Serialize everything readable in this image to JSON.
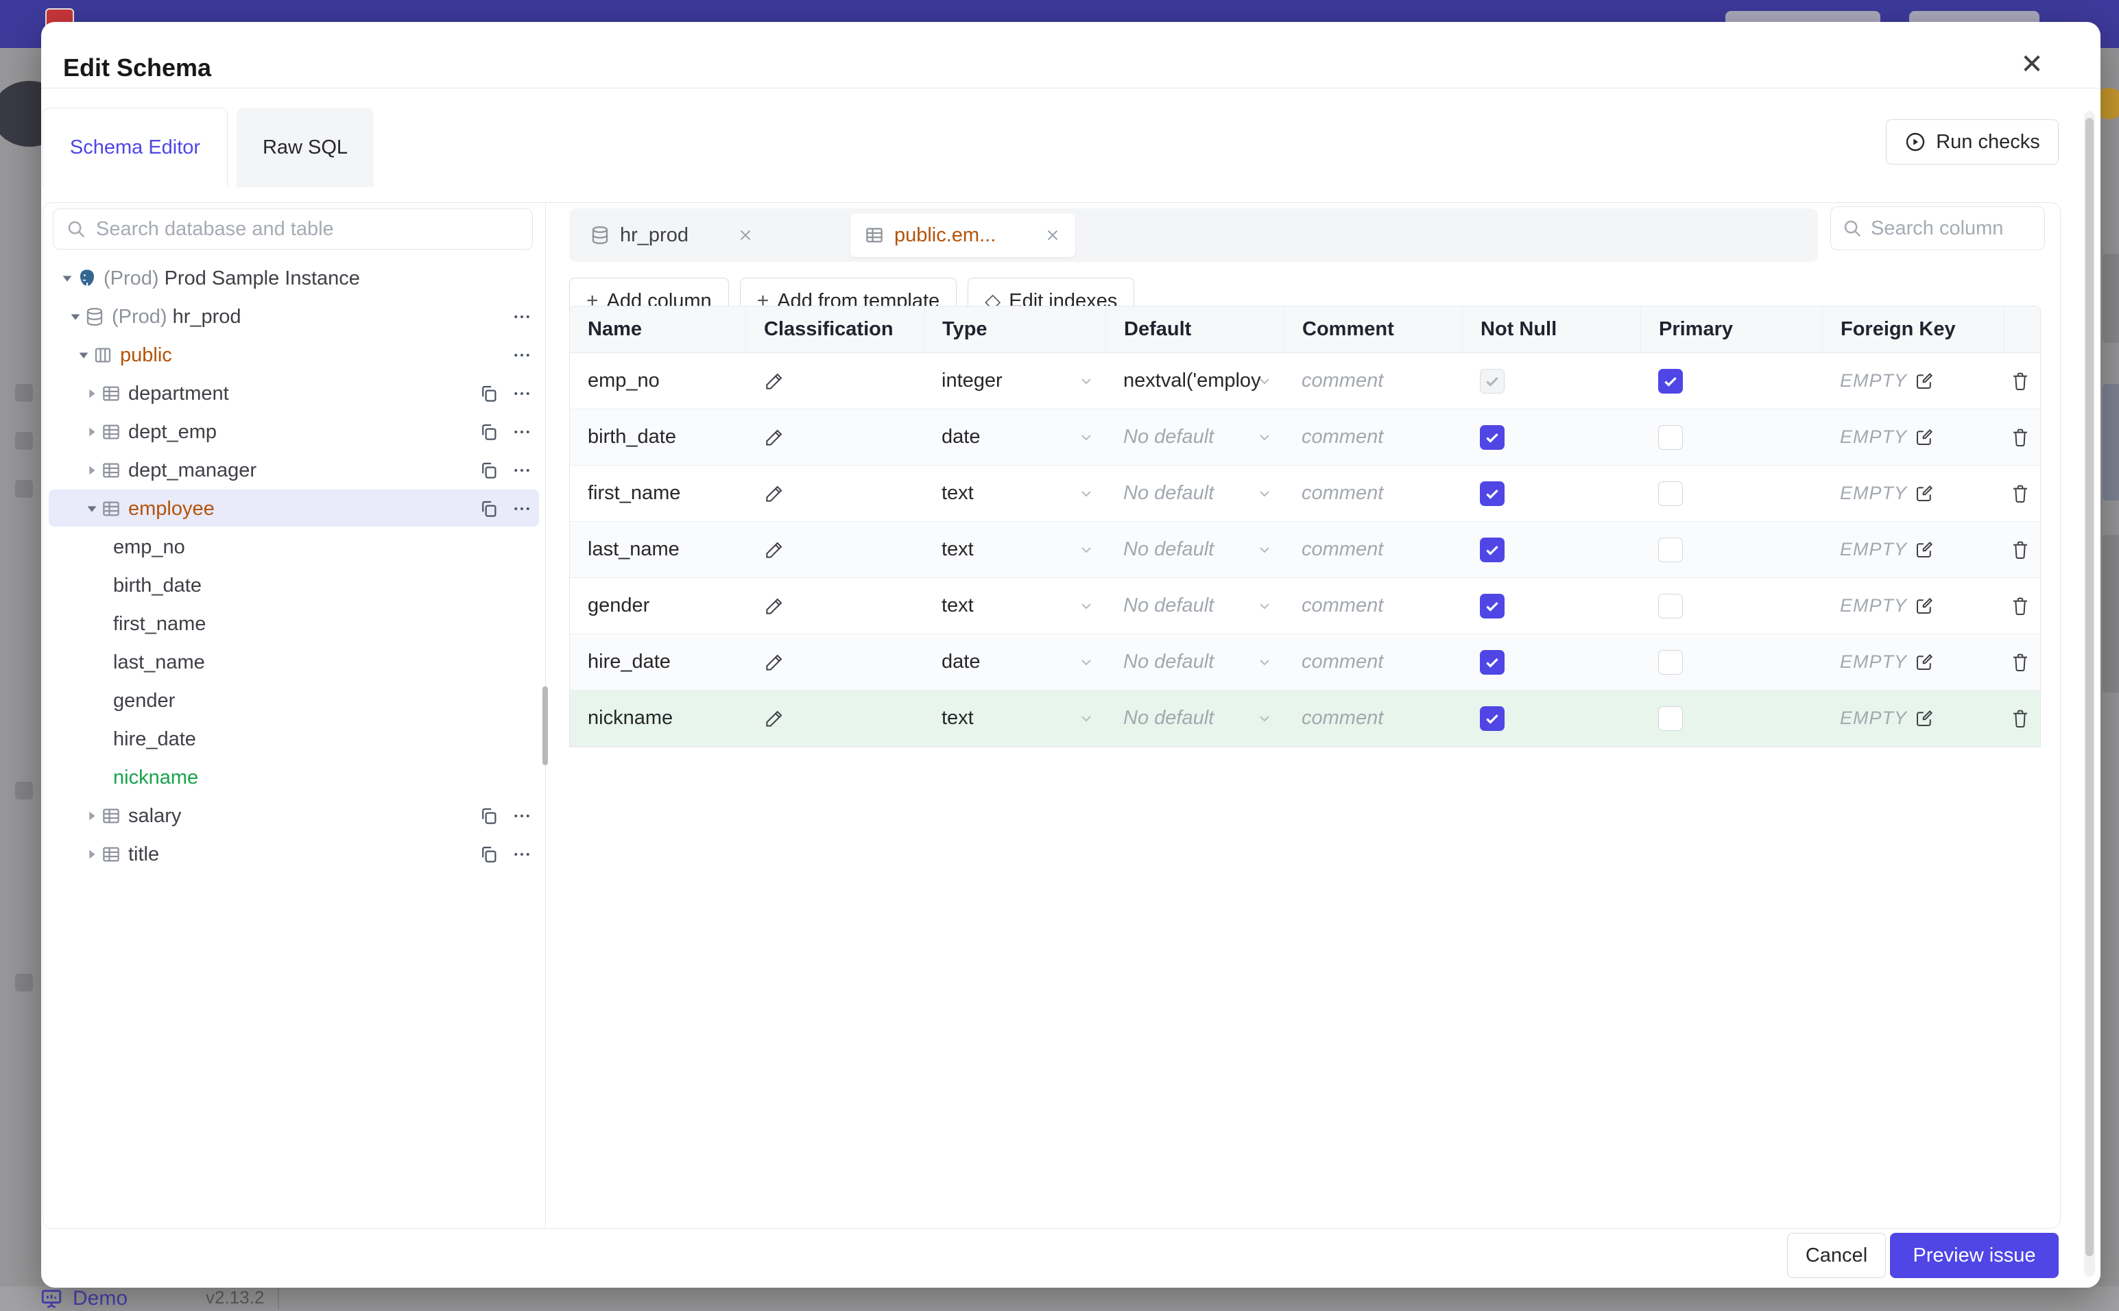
{
  "colors": {
    "accent": "#4f46e5",
    "amber": "#b45309",
    "green": "#16a34a",
    "header_purple": "#3e3a9c"
  },
  "background": {
    "brand": "Demo",
    "version": "v2.13.2"
  },
  "modal": {
    "title": "Edit Schema",
    "close": "✕",
    "tabs": [
      {
        "label": "Schema Editor",
        "active": true
      },
      {
        "label": "Raw SQL",
        "active": false
      }
    ],
    "run_checks_label": "Run checks",
    "footer": {
      "cancel_label": "Cancel",
      "submit_label": "Preview issue"
    }
  },
  "sidebar": {
    "search_placeholder": "Search database and table",
    "tree": [
      {
        "label": "Prod Sample Instance",
        "prefix": "(Prod)",
        "level": 0,
        "icon": "postgres",
        "caret": "down",
        "actions": []
      },
      {
        "label": "hr_prod",
        "prefix": "(Prod)",
        "level": 1,
        "icon": "database",
        "caret": "down",
        "actions": [
          "more"
        ]
      },
      {
        "label": "public",
        "level": 2,
        "icon": "schema",
        "caret": "down",
        "color": "amber",
        "actions": [
          "more"
        ]
      },
      {
        "label": "department",
        "level": 3,
        "icon": "table",
        "caret": "right",
        "actions": [
          "copy",
          "more"
        ]
      },
      {
        "label": "dept_emp",
        "level": 3,
        "icon": "table",
        "caret": "right",
        "actions": [
          "copy",
          "more"
        ]
      },
      {
        "label": "dept_manager",
        "level": 3,
        "icon": "table",
        "caret": "right",
        "actions": [
          "copy",
          "more"
        ]
      },
      {
        "label": "employee",
        "level": 3,
        "icon": "table",
        "caret": "down",
        "color": "amber",
        "selected": true,
        "actions": [
          "copy",
          "more"
        ]
      },
      {
        "label": "emp_no",
        "level": 4,
        "leaf": true
      },
      {
        "label": "birth_date",
        "level": 4,
        "leaf": true
      },
      {
        "label": "first_name",
        "level": 4,
        "leaf": true
      },
      {
        "label": "last_name",
        "level": 4,
        "leaf": true
      },
      {
        "label": "gender",
        "level": 4,
        "leaf": true
      },
      {
        "label": "hire_date",
        "level": 4,
        "leaf": true
      },
      {
        "label": "nickname",
        "level": 4,
        "leaf": true,
        "color": "green"
      },
      {
        "label": "salary",
        "level": 3,
        "icon": "table",
        "caret": "right",
        "actions": [
          "copy",
          "more"
        ]
      },
      {
        "label": "title",
        "level": 3,
        "icon": "table",
        "caret": "right",
        "actions": [
          "copy",
          "more"
        ]
      }
    ]
  },
  "editor": {
    "tabs": [
      {
        "label": "hr_prod",
        "icon": "database",
        "active": false
      },
      {
        "label": "public.em...",
        "icon": "table",
        "active": true,
        "color": "amber"
      }
    ],
    "toolbar": [
      {
        "label": "Add column",
        "sym": "+"
      },
      {
        "label": "Add from template",
        "sym": "+"
      },
      {
        "label": "Edit indexes",
        "sym": "◇"
      }
    ],
    "search_placeholder": "Search column",
    "table": {
      "headers": [
        "Name",
        "Classification",
        "Type",
        "Default",
        "Comment",
        "Not Null",
        "Primary",
        "Foreign Key"
      ],
      "comment_placeholder": "comment",
      "empty_label": "EMPTY",
      "no_default_label": "No default",
      "rows": [
        {
          "name": "emp_no",
          "type": "integer",
          "default": "nextval('employ",
          "has_default": true,
          "not_null": "disabled-checked",
          "primary": true,
          "state": "normal"
        },
        {
          "name": "birth_date",
          "type": "date",
          "default": "No default",
          "has_default": false,
          "not_null": "checked",
          "primary": false,
          "state": "alt"
        },
        {
          "name": "first_name",
          "type": "text",
          "default": "No default",
          "has_default": false,
          "not_null": "checked",
          "primary": false,
          "state": "normal"
        },
        {
          "name": "last_name",
          "type": "text",
          "default": "No default",
          "has_default": false,
          "not_null": "checked",
          "primary": false,
          "state": "alt"
        },
        {
          "name": "gender",
          "type": "text",
          "default": "No default",
          "has_default": false,
          "not_null": "checked",
          "primary": false,
          "state": "normal"
        },
        {
          "name": "hire_date",
          "type": "date",
          "default": "No default",
          "has_default": false,
          "not_null": "checked",
          "primary": false,
          "state": "alt"
        },
        {
          "name": "nickname",
          "type": "text",
          "default": "No default",
          "has_default": false,
          "not_null": "checked",
          "primary": false,
          "state": "new"
        }
      ]
    }
  }
}
